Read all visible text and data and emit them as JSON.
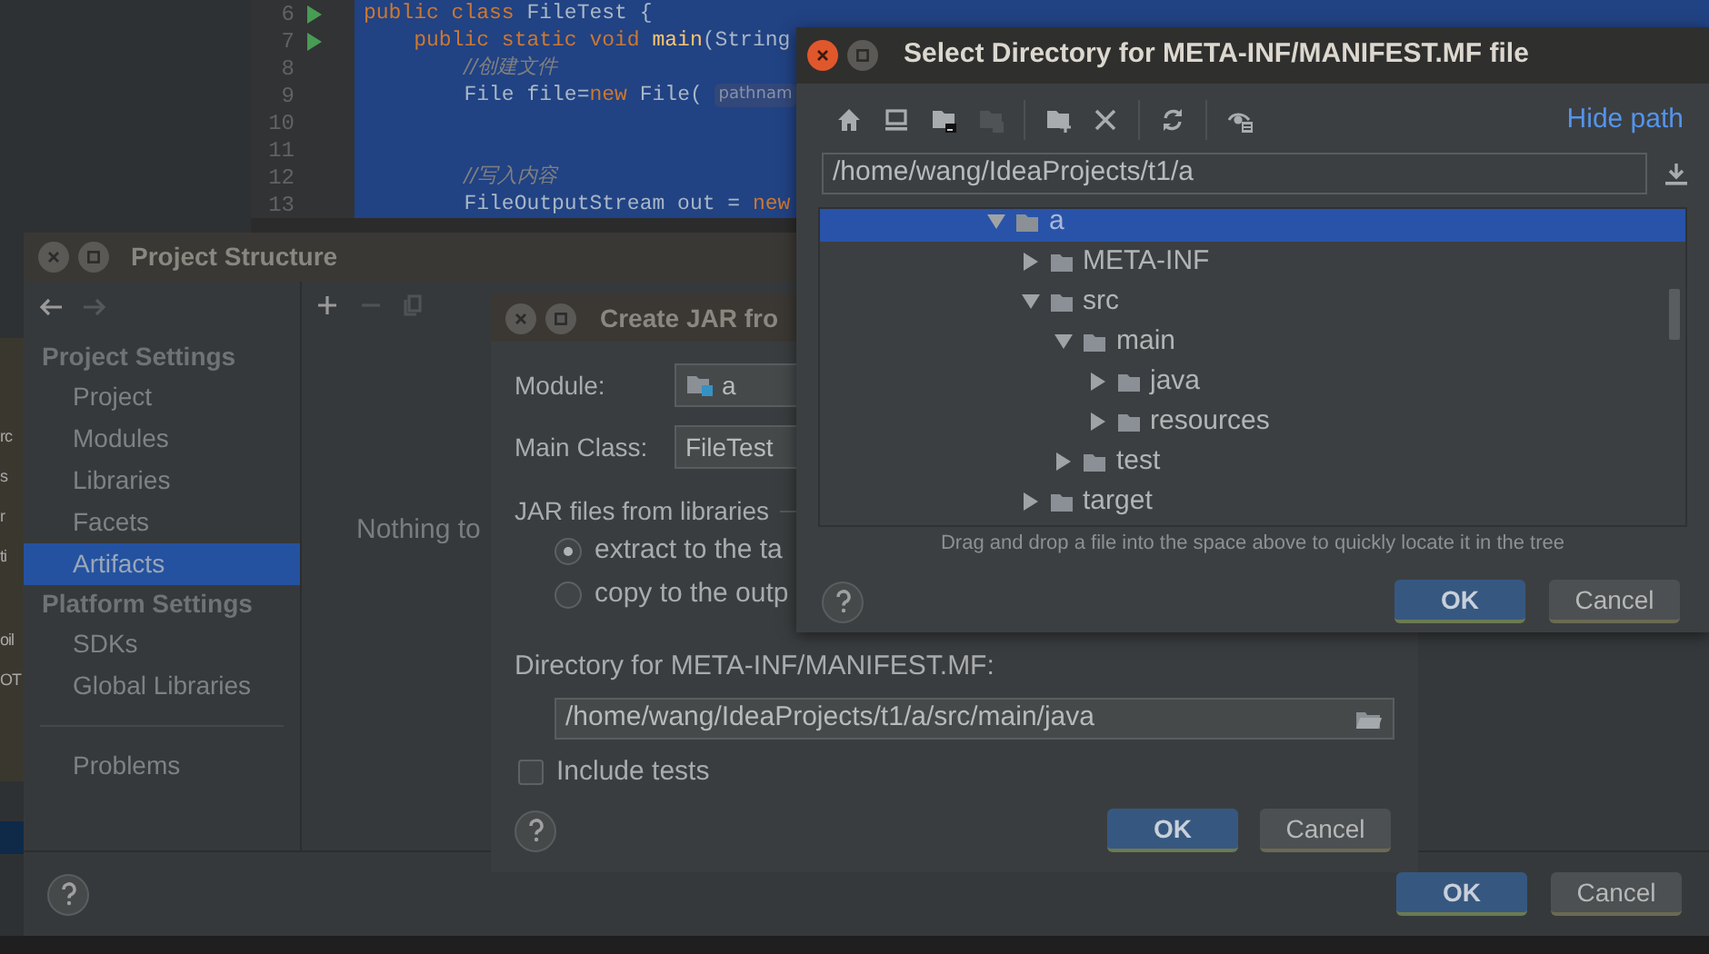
{
  "ide": {
    "left_panel_fragments": [
      {
        "text": "rc"
      },
      {
        "text": "s"
      },
      {
        "text": "r"
      },
      {
        "text": "ti"
      },
      {
        "text": "oil"
      },
      {
        "text": "OT"
      }
    ],
    "editor": {
      "lines": [
        {
          "number": "6",
          "run": true,
          "selected": true,
          "segments": [
            {
              "kind": "keyword",
              "text": "public class "
            },
            {
              "kind": "plain",
              "text": "FileTest {"
            }
          ]
        },
        {
          "number": "7",
          "run": true,
          "selected": true,
          "segments": [
            {
              "kind": "keyword",
              "text": "    public static void "
            },
            {
              "kind": "method",
              "text": "main"
            },
            {
              "kind": "plain",
              "text": "(String"
            }
          ]
        },
        {
          "number": "8",
          "run": false,
          "selected": true,
          "segments": [
            {
              "kind": "comment",
              "text": "        //创建文件"
            }
          ]
        },
        {
          "number": "9",
          "run": false,
          "selected": true,
          "segments": [
            {
              "kind": "plain",
              "text": "        File file="
            },
            {
              "kind": "keyword",
              "text": "new"
            },
            {
              "kind": "plain",
              "text": " File( "
            },
            {
              "kind": "hint",
              "text": "pathnam"
            }
          ]
        },
        {
          "number": "10",
          "run": false,
          "selected": true
        },
        {
          "number": "11",
          "run": false,
          "selected": true
        },
        {
          "number": "12",
          "run": false,
          "selected": true,
          "segments": [
            {
              "kind": "comment",
              "text": "        //写入内容"
            }
          ]
        },
        {
          "number": "13",
          "run": false,
          "selected": true,
          "segments": [
            {
              "kind": "plain",
              "text": "        FileOutputStream out = "
            },
            {
              "kind": "keyword",
              "text": "new"
            }
          ]
        }
      ]
    }
  },
  "project_structure": {
    "title": "Project Structure",
    "nav": [
      {
        "kind": "back",
        "disabled": false
      },
      {
        "kind": "forward",
        "disabled": true
      }
    ],
    "sections": [
      {
        "heading": "Project Settings",
        "items": [
          {
            "label": "Project",
            "selected": false
          },
          {
            "label": "Modules",
            "selected": false
          },
          {
            "label": "Libraries",
            "selected": false
          },
          {
            "label": "Facets",
            "selected": false
          },
          {
            "label": "Artifacts",
            "selected": true
          }
        ]
      },
      {
        "heading": "Platform Settings",
        "items": [
          {
            "label": "SDKs",
            "selected": false
          },
          {
            "label": "Global Libraries",
            "selected": false
          }
        ]
      }
    ],
    "footer_items": [
      {
        "label": "Problems",
        "selected": false
      }
    ],
    "toolbar": [
      {
        "kind": "add",
        "disabled": false
      },
      {
        "kind": "remove",
        "disabled": true
      },
      {
        "kind": "copy",
        "disabled": true
      }
    ],
    "empty_text": "Nothing to",
    "buttons": [
      {
        "label": "OK",
        "default": true
      },
      {
        "label": "Cancel",
        "default": false
      }
    ]
  },
  "create_jar": {
    "title": "Create JAR fro",
    "module": {
      "label": "Module:",
      "value": "a"
    },
    "main_class": {
      "label": "Main Class:",
      "value": "FileTest"
    },
    "libraries_group": "JAR files from libraries",
    "options": [
      {
        "label": "extract to the ta",
        "selected": true
      },
      {
        "label": "copy to the outp",
        "selected": false
      }
    ],
    "directory": {
      "label": "Directory for META-INF/MANIFEST.MF:",
      "value": "/home/wang/IdeaProjects/t1/a/src/main/java"
    },
    "include_tests": {
      "label": "Include tests",
      "checked": false
    },
    "buttons": [
      {
        "label": "OK",
        "default": true
      },
      {
        "label": "Cancel",
        "default": false
      }
    ]
  },
  "select_directory": {
    "title": "Select Directory for META-INF/MANIFEST.MF file",
    "toolbar": [
      {
        "kind": "home",
        "disabled": false
      },
      {
        "kind": "desktop",
        "disabled": false
      },
      {
        "kind": "project",
        "disabled": false
      },
      {
        "kind": "module",
        "disabled": true
      },
      {
        "kind": "separator"
      },
      {
        "kind": "new-folder",
        "disabled": false
      },
      {
        "kind": "delete",
        "disabled": false
      },
      {
        "kind": "separator"
      },
      {
        "kind": "refresh",
        "disabled": false
      },
      {
        "kind": "separator"
      },
      {
        "kind": "hidden",
        "disabled": false
      }
    ],
    "hide_path": "Hide path",
    "path": "/home/wang/IdeaProjects/t1/a",
    "tree": [
      {
        "label": "a",
        "expanded": true,
        "selected": true,
        "children": [
          {
            "label": "META-INF",
            "expanded": false,
            "selected": false
          },
          {
            "label": "src",
            "expanded": true,
            "selected": false,
            "children": [
              {
                "label": "main",
                "expanded": true,
                "selected": false,
                "children": [
                  {
                    "label": "java",
                    "expanded": false,
                    "selected": false
                  },
                  {
                    "label": "resources",
                    "expanded": false,
                    "selected": false
                  }
                ]
              },
              {
                "label": "test",
                "expanded": false,
                "selected": false
              }
            ]
          },
          {
            "label": "target",
            "expanded": false,
            "selected": false
          }
        ]
      }
    ],
    "hint": "Drag and drop a file into the space above to quickly locate it in the tree",
    "buttons": [
      {
        "label": "OK",
        "default": true
      },
      {
        "label": "Cancel",
        "default": false
      }
    ]
  }
}
